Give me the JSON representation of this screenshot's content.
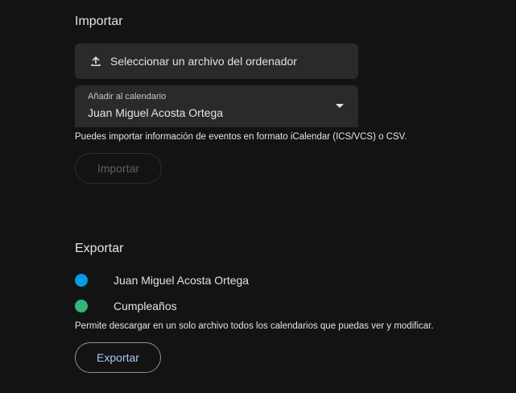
{
  "import": {
    "title": "Importar",
    "file_button_label": "Seleccionar un archivo del ordenador",
    "file_button_icon": "upload-icon",
    "calendar_select": {
      "label": "Añadir al calendario",
      "value": "Juan Miguel Acosta Ortega",
      "arrow_icon": "dropdown-arrow-icon"
    },
    "help_text": "Puedes importar información de eventos en formato iCalendar (ICS/VCS) o CSV.",
    "button_label": "Importar",
    "button_disabled": true
  },
  "export": {
    "title": "Exportar",
    "calendars": [
      {
        "name": "Juan Miguel Acosta Ortega",
        "color": "#039be5"
      },
      {
        "name": "Cumpleaños",
        "color": "#33b679"
      }
    ],
    "help_text": "Permite descargar en un solo archivo todos los calendarios que puedas ver y modificar.",
    "button_label": "Exportar"
  },
  "colors": {
    "background": "#131314",
    "surface": "#282a2c",
    "accent": "#a8c7fa"
  }
}
